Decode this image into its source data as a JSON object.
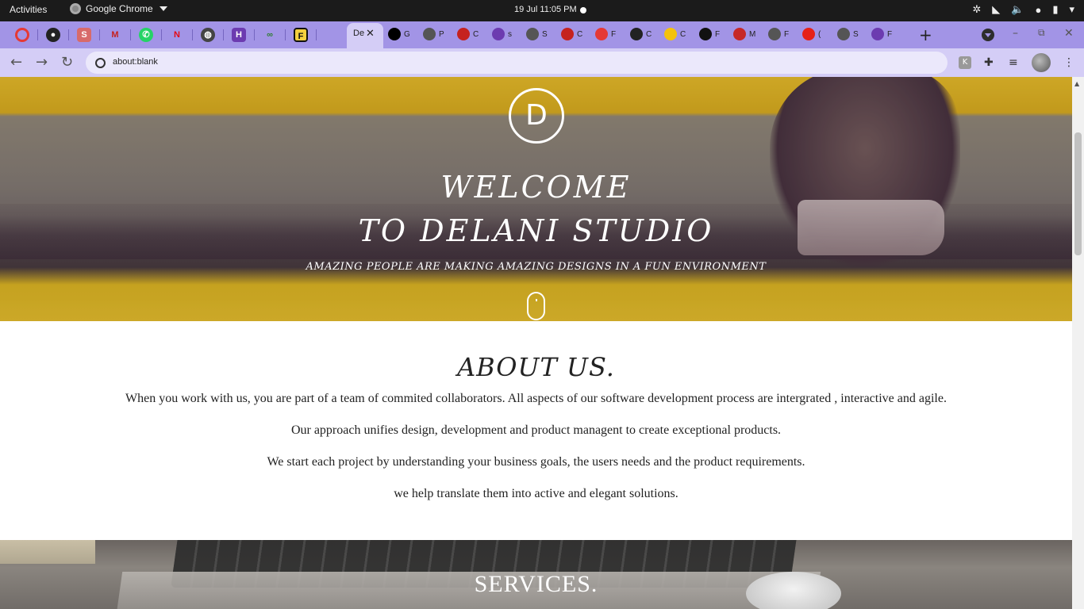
{
  "system_bar": {
    "activities": "Activities",
    "app_name": "Google Chrome",
    "clock": "19 Jul  11:05 PM"
  },
  "browser": {
    "active_tab_title": "De",
    "url": "about:blank",
    "other_tabs": [
      {
        "icon": "angular-icon",
        "label": "G",
        "color": "#000000"
      },
      {
        "icon": "globe-icon",
        "label": "P",
        "color": "#555555"
      },
      {
        "icon": "gmail-icon",
        "label": "C",
        "color": "#c5221f"
      },
      {
        "icon": "heroku-icon",
        "label": "s",
        "color": "#6c3bb0"
      },
      {
        "icon": "globe-icon",
        "label": "S",
        "color": "#555555"
      },
      {
        "icon": "gmail-icon",
        "label": "C",
        "color": "#c5221f"
      },
      {
        "icon": "ring-icon",
        "label": "F",
        "color": "#e53935"
      },
      {
        "icon": "github-icon",
        "label": "C",
        "color": "#222222"
      },
      {
        "icon": "keep-icon",
        "label": "C",
        "color": "#f4c20d"
      },
      {
        "icon": "wordpress-icon",
        "label": "F",
        "color": "#111111"
      },
      {
        "icon": "m-icon",
        "label": "M",
        "color": "#c62828"
      },
      {
        "icon": "globe-icon",
        "label": "F",
        "color": "#555555"
      },
      {
        "icon": "youtube-icon",
        "label": "(",
        "color": "#e62117"
      },
      {
        "icon": "globe-icon",
        "label": "S",
        "color": "#555555"
      },
      {
        "icon": "heroku-icon",
        "label": "F",
        "color": "#6c3bb0"
      }
    ],
    "accent": "#a294e6"
  },
  "hero": {
    "logo_letter": "D",
    "title_line1": "WELCOME",
    "title_line2": "TO DELANI STUDIO",
    "subtitle": "AMAZING PEOPLE ARE MAKING AMAZING DESIGNS IN A FUN ENVIRONMENT"
  },
  "about": {
    "title": "ABOUT US.",
    "paragraphs": [
      "When you work with us, you are part of a team of commited collaborators. All aspects of our software development process are intergrated , interactive and agile.",
      "Our approach unifies design, development and product managent to create exceptional products.",
      "We start each project by understanding your business goals, the users needs and the product requirements.",
      "we help translate them into active and elegant solutions."
    ]
  },
  "services": {
    "title": "SERVICES."
  }
}
